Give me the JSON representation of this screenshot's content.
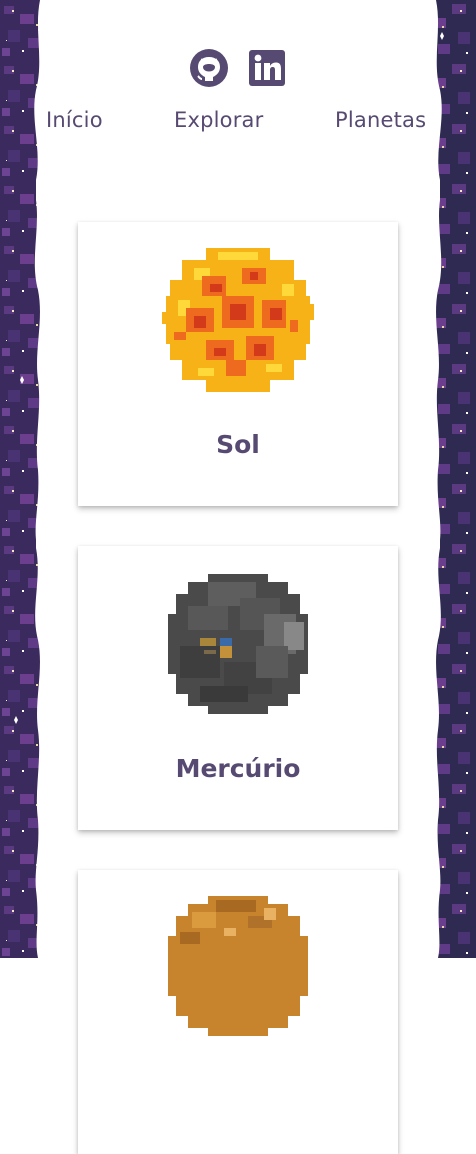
{
  "social": {
    "github_icon": "github-icon",
    "linkedin_icon": "linkedin-icon"
  },
  "nav": {
    "items": [
      {
        "label": "Início"
      },
      {
        "label": "Explorar"
      },
      {
        "label": "Planetas"
      }
    ]
  },
  "planets": [
    {
      "name": "Sol",
      "image": "sun-pixel-art"
    },
    {
      "name": "Mercúrio",
      "image": "mercury-pixel-art"
    },
    {
      "name": "",
      "image": "venus-pixel-art"
    }
  ],
  "colors": {
    "text": "#574a72",
    "space_dark": "#2a2648",
    "space_purple": "#5a3478"
  }
}
